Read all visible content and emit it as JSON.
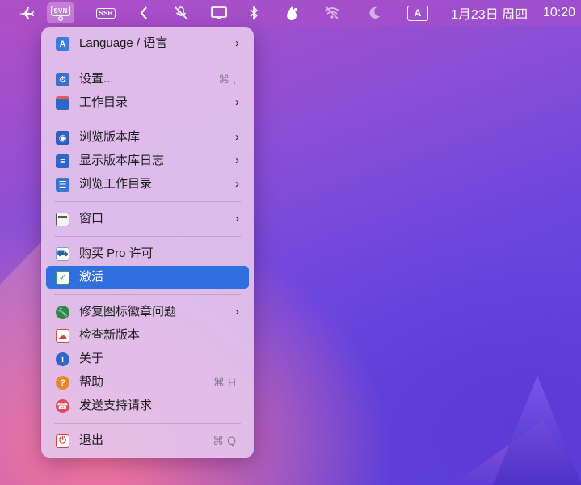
{
  "menubar": {
    "icons": {
      "airplane": "airplane-icon",
      "svn": "SVN",
      "ssh": "SSH",
      "chevron": "chevron-left-icon",
      "mute": "mute-mic-icon",
      "display": "display-icon",
      "bluetooth": "bluetooth-icon",
      "drop": "water-drop-icon",
      "wifi_off": "wifi-off-icon",
      "moon": "moon-icon",
      "input_method": "A"
    },
    "date": "1月23日 周四",
    "time": "10:20"
  },
  "menu": {
    "items": [
      {
        "label": "Language / 语言",
        "icon": "language-icon",
        "submenu": true
      },
      {
        "label": "设置...",
        "icon": "settings-icon",
        "shortcut": "⌘ ,"
      },
      {
        "label": "工作目录",
        "icon": "folder-icon",
        "submenu": true
      },
      {
        "label": "浏览版本库",
        "icon": "repo-browse-icon",
        "submenu": true
      },
      {
        "label": "显示版本库日志",
        "icon": "log-icon",
        "submenu": true
      },
      {
        "label": "浏览工作目录",
        "icon": "working-copy-icon",
        "submenu": true
      },
      {
        "label": "窗口",
        "icon": "window-icon",
        "submenu": true
      },
      {
        "label": "购买 Pro 许可",
        "icon": "cart-icon"
      },
      {
        "label": "激活",
        "icon": "activate-check-icon",
        "highlighted": true
      },
      {
        "label": "修复图标徽章问题",
        "icon": "wrench-icon",
        "submenu": true
      },
      {
        "label": "检查新版本",
        "icon": "cloud-update-icon"
      },
      {
        "label": "关于",
        "icon": "info-icon"
      },
      {
        "label": "帮助",
        "icon": "help-icon",
        "shortcut": "⌘ H"
      },
      {
        "label": "发送支持请求",
        "icon": "support-icon"
      },
      {
        "label": "退出",
        "icon": "power-icon",
        "shortcut": "⌘ Q"
      }
    ],
    "arrow": "›"
  },
  "colors": {
    "highlight": "#2f6fe0",
    "menu_bg": "#e4c4ec"
  }
}
